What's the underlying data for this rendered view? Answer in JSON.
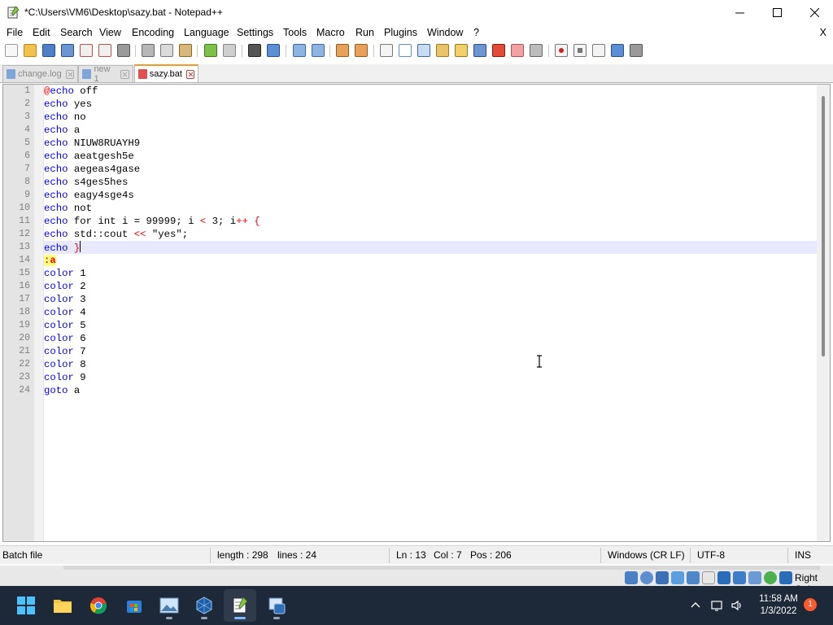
{
  "window": {
    "title": "*C:\\Users\\VM6\\Desktop\\sazy.bat - Notepad++"
  },
  "menu": {
    "items": [
      "File",
      "Edit",
      "Search",
      "View",
      "Encoding",
      "Language",
      "Settings",
      "Tools",
      "Macro",
      "Run",
      "Plugins",
      "Window",
      "?"
    ],
    "close_doc": "X"
  },
  "tabs": [
    {
      "label": "change.log",
      "active": false
    },
    {
      "label": "new 1",
      "active": false
    },
    {
      "label": "sazy.bat",
      "active": true
    }
  ],
  "editor": {
    "lines": [
      {
        "num": "1",
        "parts": [
          [
            "op",
            "@"
          ],
          [
            "kw",
            "echo"
          ],
          [
            "txt",
            " off"
          ]
        ]
      },
      {
        "num": "2",
        "parts": [
          [
            "kw",
            "echo"
          ],
          [
            "txt",
            " yes"
          ]
        ]
      },
      {
        "num": "3",
        "parts": [
          [
            "kw",
            "echo"
          ],
          [
            "txt",
            " no"
          ]
        ]
      },
      {
        "num": "4",
        "parts": [
          [
            "kw",
            "echo"
          ],
          [
            "txt",
            " a"
          ]
        ]
      },
      {
        "num": "5",
        "parts": [
          [
            "kw",
            "echo"
          ],
          [
            "txt",
            " NIUW8RUAYH9"
          ]
        ]
      },
      {
        "num": "6",
        "parts": [
          [
            "kw",
            "echo"
          ],
          [
            "txt",
            " aeatgesh5e"
          ]
        ]
      },
      {
        "num": "7",
        "parts": [
          [
            "kw",
            "echo"
          ],
          [
            "txt",
            " aegeas4gase"
          ]
        ]
      },
      {
        "num": "8",
        "parts": [
          [
            "kw",
            "echo"
          ],
          [
            "txt",
            " s4ges5hes"
          ]
        ]
      },
      {
        "num": "9",
        "parts": [
          [
            "kw",
            "echo"
          ],
          [
            "txt",
            " eagy4sge4s"
          ]
        ]
      },
      {
        "num": "10",
        "parts": [
          [
            "kw",
            "echo"
          ],
          [
            "txt",
            " not"
          ]
        ]
      },
      {
        "num": "11",
        "parts": [
          [
            "kw",
            "echo"
          ],
          [
            "txt",
            " for int i = 99999; i "
          ],
          [
            "op",
            "<"
          ],
          [
            "txt",
            " 3; i"
          ],
          [
            "op",
            "++"
          ],
          [
            "txt",
            " "
          ],
          [
            "op",
            "{"
          ]
        ]
      },
      {
        "num": "12",
        "parts": [
          [
            "kw",
            "echo"
          ],
          [
            "txt",
            " std::cout "
          ],
          [
            "op",
            "<<"
          ],
          [
            "txt",
            " \"yes\";"
          ]
        ]
      },
      {
        "num": "13",
        "parts": [
          [
            "kw",
            "echo"
          ],
          [
            "txt",
            " "
          ],
          [
            "op",
            "}"
          ]
        ],
        "current": true
      },
      {
        "num": "14",
        "parts": [
          [
            "lbl",
            ":a"
          ]
        ]
      },
      {
        "num": "15",
        "parts": [
          [
            "kw",
            "color"
          ],
          [
            "txt",
            " 1"
          ]
        ]
      },
      {
        "num": "16",
        "parts": [
          [
            "kw",
            "color"
          ],
          [
            "txt",
            " 2"
          ]
        ]
      },
      {
        "num": "17",
        "parts": [
          [
            "kw",
            "color"
          ],
          [
            "txt",
            " 3"
          ]
        ]
      },
      {
        "num": "18",
        "parts": [
          [
            "kw",
            "color"
          ],
          [
            "txt",
            " 4"
          ]
        ]
      },
      {
        "num": "19",
        "parts": [
          [
            "kw",
            "color"
          ],
          [
            "txt",
            " 5"
          ]
        ]
      },
      {
        "num": "20",
        "parts": [
          [
            "kw",
            "color"
          ],
          [
            "txt",
            " 6"
          ]
        ]
      },
      {
        "num": "21",
        "parts": [
          [
            "kw",
            "color"
          ],
          [
            "txt",
            " 7"
          ]
        ]
      },
      {
        "num": "22",
        "parts": [
          [
            "kw",
            "color"
          ],
          [
            "txt",
            " 8"
          ]
        ]
      },
      {
        "num": "23",
        "parts": [
          [
            "kw",
            "color"
          ],
          [
            "txt",
            " 9"
          ]
        ]
      },
      {
        "num": "24",
        "parts": [
          [
            "kw",
            "goto"
          ],
          [
            "txt",
            " a"
          ]
        ]
      }
    ]
  },
  "status": {
    "filetype": "Batch file",
    "length": "length : 298",
    "lines": "lines : 24",
    "ln": "Ln : 13",
    "col": "Col : 7",
    "pos": "Pos : 206",
    "eol": "Windows (CR LF)",
    "encoding": "UTF-8",
    "mode": "INS"
  },
  "host": {
    "right_ctrl": "Right Ctrl"
  },
  "taskbar": {
    "time": "11:58 AM",
    "date": "1/3/2022",
    "notifications": "1"
  },
  "colors": {
    "keyword": "#0000ff",
    "operator": "#ff0000",
    "label_bg": "#ffff80",
    "current_line": "#e8e8ff",
    "tab_accent": "#f59a23",
    "taskbar_bg": "#1d2838"
  }
}
